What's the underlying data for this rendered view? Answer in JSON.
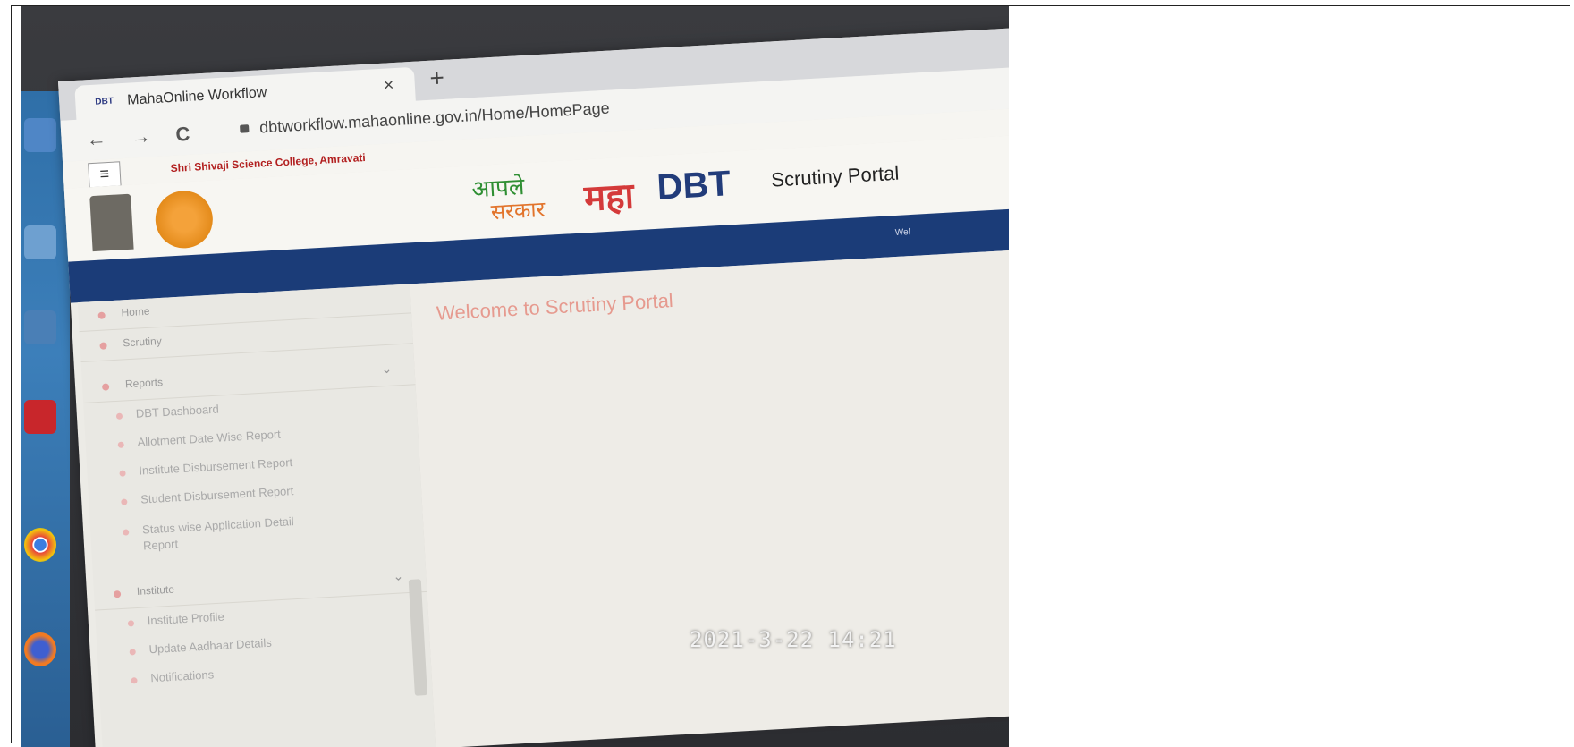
{
  "browser": {
    "tab_favicon": "DBT",
    "tab_title": "MahaOnline Workflow",
    "tab_close": "×",
    "new_tab": "+",
    "back": "←",
    "forward": "→",
    "reload": "C",
    "url": "dbtworkflow.mahaonline.gov.in/Home/HomePage"
  },
  "header": {
    "menu_icon": "≡",
    "college": "Shri Shivaji Science College, Amravati",
    "logo_aaple": "आपले",
    "logo_sarkar": "सरकार",
    "logo_maha": "महा",
    "logo_dbt": "DBT",
    "portal_title": "Scrutiny Portal",
    "welcome_small": "Wel"
  },
  "sidebar": {
    "items": [
      {
        "label": "Home"
      },
      {
        "label": "Scrutiny"
      },
      {
        "label": "Reports"
      },
      {
        "label": "Institute"
      }
    ],
    "reports_sub": [
      {
        "label": "DBT Dashboard"
      },
      {
        "label": "Allotment Date Wise Report"
      },
      {
        "label": "Institute Disbursement Report"
      },
      {
        "label": "Student Disbursement Report"
      },
      {
        "label": "Status wise Application Detail"
      },
      {
        "label": "Report"
      }
    ],
    "institute_sub": [
      {
        "label": "Institute Profile"
      },
      {
        "label": "Update Aadhaar Details"
      },
      {
        "label": "Notifications"
      }
    ]
  },
  "main": {
    "welcome": "Welcome to Scrutiny Portal"
  },
  "photo": {
    "timestamp": "2021-3-22 14:21"
  },
  "colors": {
    "nav_blue": "#1b3c78",
    "maha_red": "#d43a3a",
    "college_red": "#b21f1f",
    "welcome_salmon": "#e69a8f"
  }
}
